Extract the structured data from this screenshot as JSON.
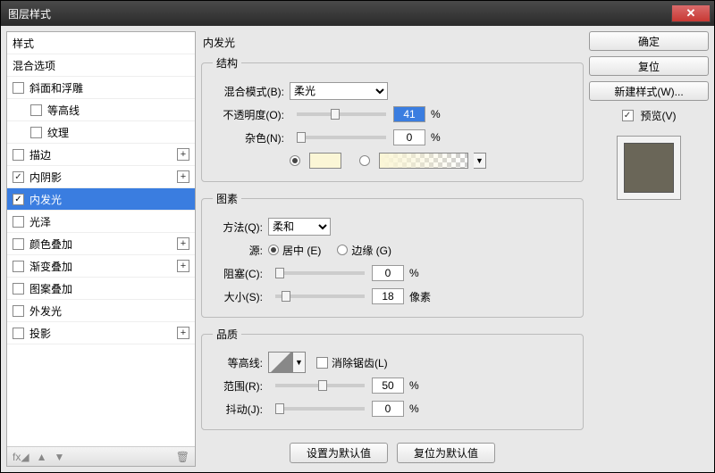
{
  "window": {
    "title": "图层样式"
  },
  "buttons": {
    "ok": "确定",
    "cancel": "复位",
    "newstyle": "新建样式(W)...",
    "preview": "预览(V)",
    "setdefault": "设置为默认值",
    "resetdefault": "复位为默认值"
  },
  "styles": {
    "header": "样式",
    "blend": "混合选项",
    "items": [
      {
        "label": "斜面和浮雕",
        "checked": false,
        "expand": false
      },
      {
        "label": "等高线",
        "checked": false,
        "indent": true
      },
      {
        "label": "纹理",
        "checked": false,
        "indent": true
      },
      {
        "label": "描边",
        "checked": false,
        "expand": true
      },
      {
        "label": "内阴影",
        "checked": true,
        "expand": true
      },
      {
        "label": "内发光",
        "checked": true,
        "selected": true
      },
      {
        "label": "光泽",
        "checked": false
      },
      {
        "label": "颜色叠加",
        "checked": false,
        "expand": true
      },
      {
        "label": "渐变叠加",
        "checked": false,
        "expand": true
      },
      {
        "label": "图案叠加",
        "checked": false
      },
      {
        "label": "外发光",
        "checked": false
      },
      {
        "label": "投影",
        "checked": false,
        "expand": true
      }
    ]
  },
  "panel": {
    "title": "内发光",
    "structure": {
      "legend": "结构",
      "blendmode_label": "混合模式(B):",
      "blendmode_value": "柔光",
      "opacity_label": "不透明度(O):",
      "opacity_value": "41",
      "opacity_unit": "%",
      "noise_label": "杂色(N):",
      "noise_value": "0",
      "noise_unit": "%",
      "swatch_color": "#fbf6d6"
    },
    "elements": {
      "legend": "图素",
      "technique_label": "方法(Q):",
      "technique_value": "柔和",
      "source_label": "源:",
      "center": "居中 (E)",
      "edge": "边缘 (G)",
      "source_value": "center",
      "choke_label": "阻塞(C):",
      "choke_value": "0",
      "choke_unit": "%",
      "size_label": "大小(S):",
      "size_value": "18",
      "size_unit": "像素"
    },
    "quality": {
      "legend": "品质",
      "contour_label": "等高线:",
      "antialias": "消除锯齿(L)",
      "antialias_checked": false,
      "range_label": "范围(R):",
      "range_value": "50",
      "range_unit": "%",
      "jitter_label": "抖动(J):",
      "jitter_value": "0",
      "jitter_unit": "%"
    }
  }
}
